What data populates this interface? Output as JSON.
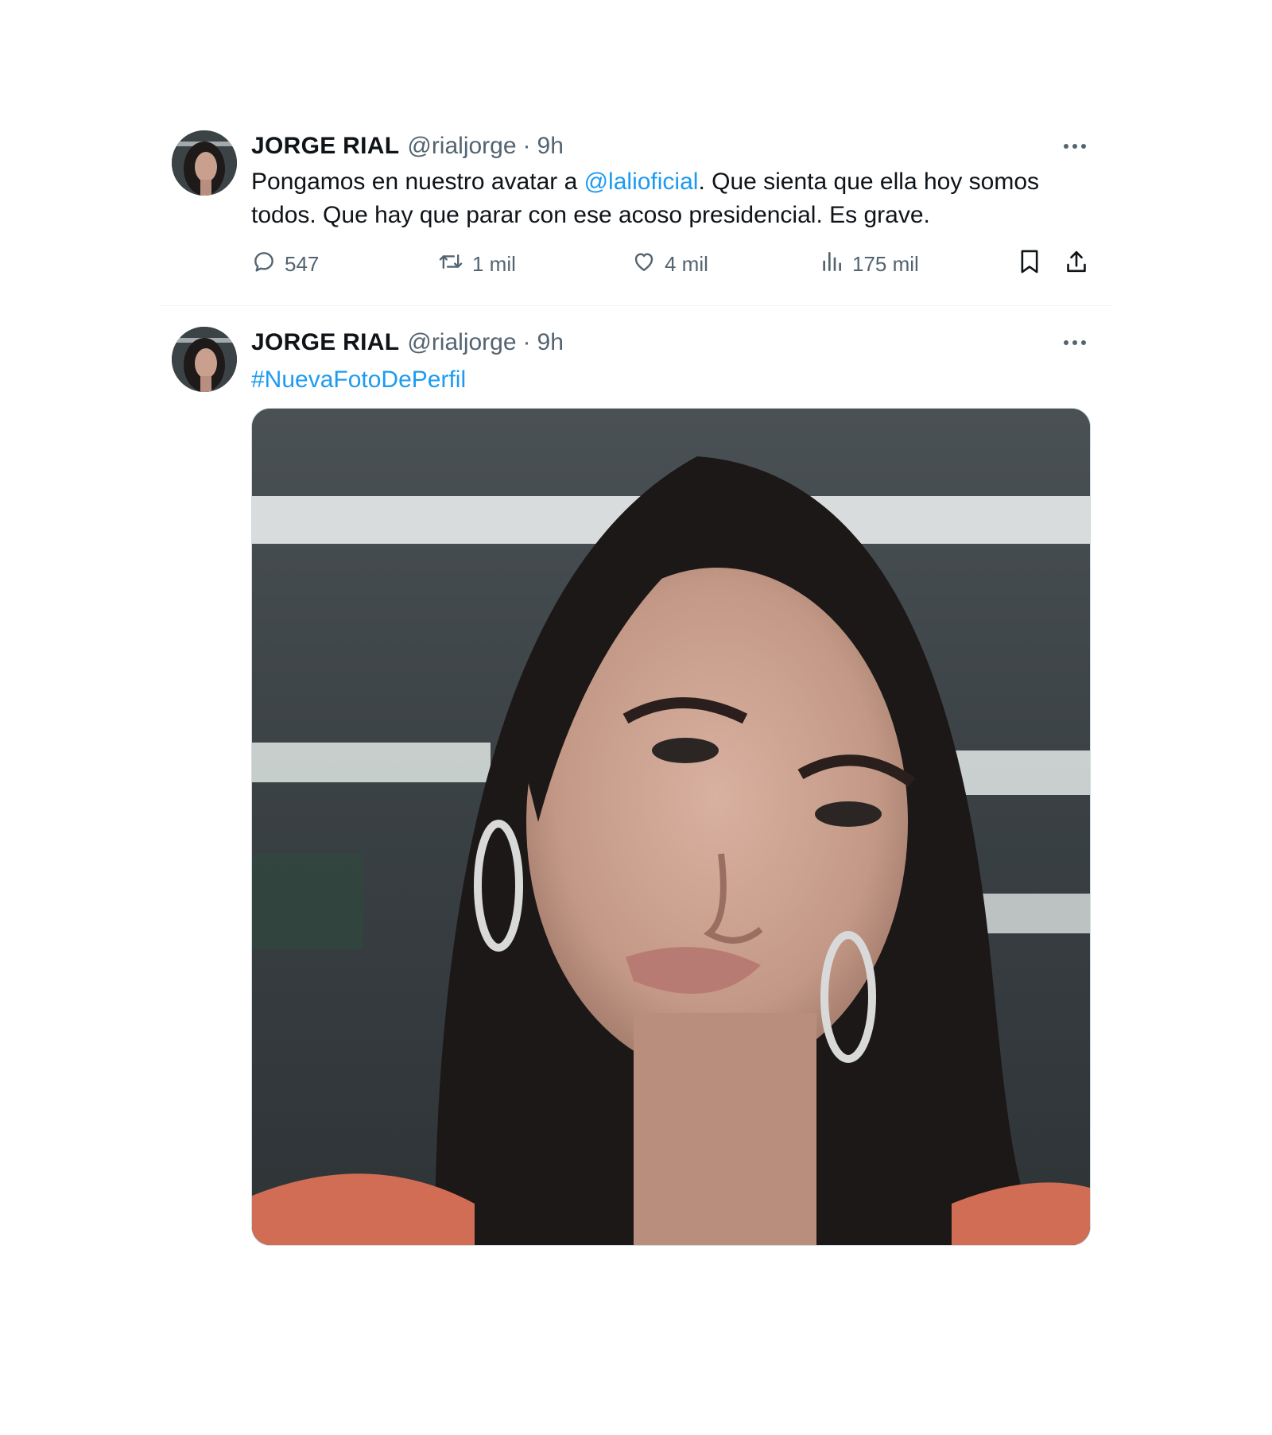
{
  "tweets": [
    {
      "author": {
        "display_name": "JORGE RIAL",
        "handle": "@rialjorge"
      },
      "separator": "·",
      "time": "9h",
      "text_parts": {
        "before": "Pongamos en nuestro avatar a ",
        "mention": "@lalioficial",
        "after": ". Que sienta que ella hoy somos todos. Que hay que parar con ese acoso presidencial. Es grave."
      },
      "stats": {
        "replies": "547",
        "retweets": "1 mil",
        "likes": "4 mil",
        "views": "175 mil"
      }
    },
    {
      "author": {
        "display_name": "JORGE RIAL",
        "handle": "@rialjorge"
      },
      "separator": "·",
      "time": "9h",
      "hashtag": "#NuevaFotoDePerfil"
    }
  ],
  "colors": {
    "text": "#0f1419",
    "secondary": "#536471",
    "link": "#1d9bf0",
    "divider": "#eff3f4"
  },
  "icons": [
    "more-icon",
    "reply-icon",
    "retweet-icon",
    "like-icon",
    "views-icon",
    "bookmark-icon",
    "share-icon"
  ]
}
